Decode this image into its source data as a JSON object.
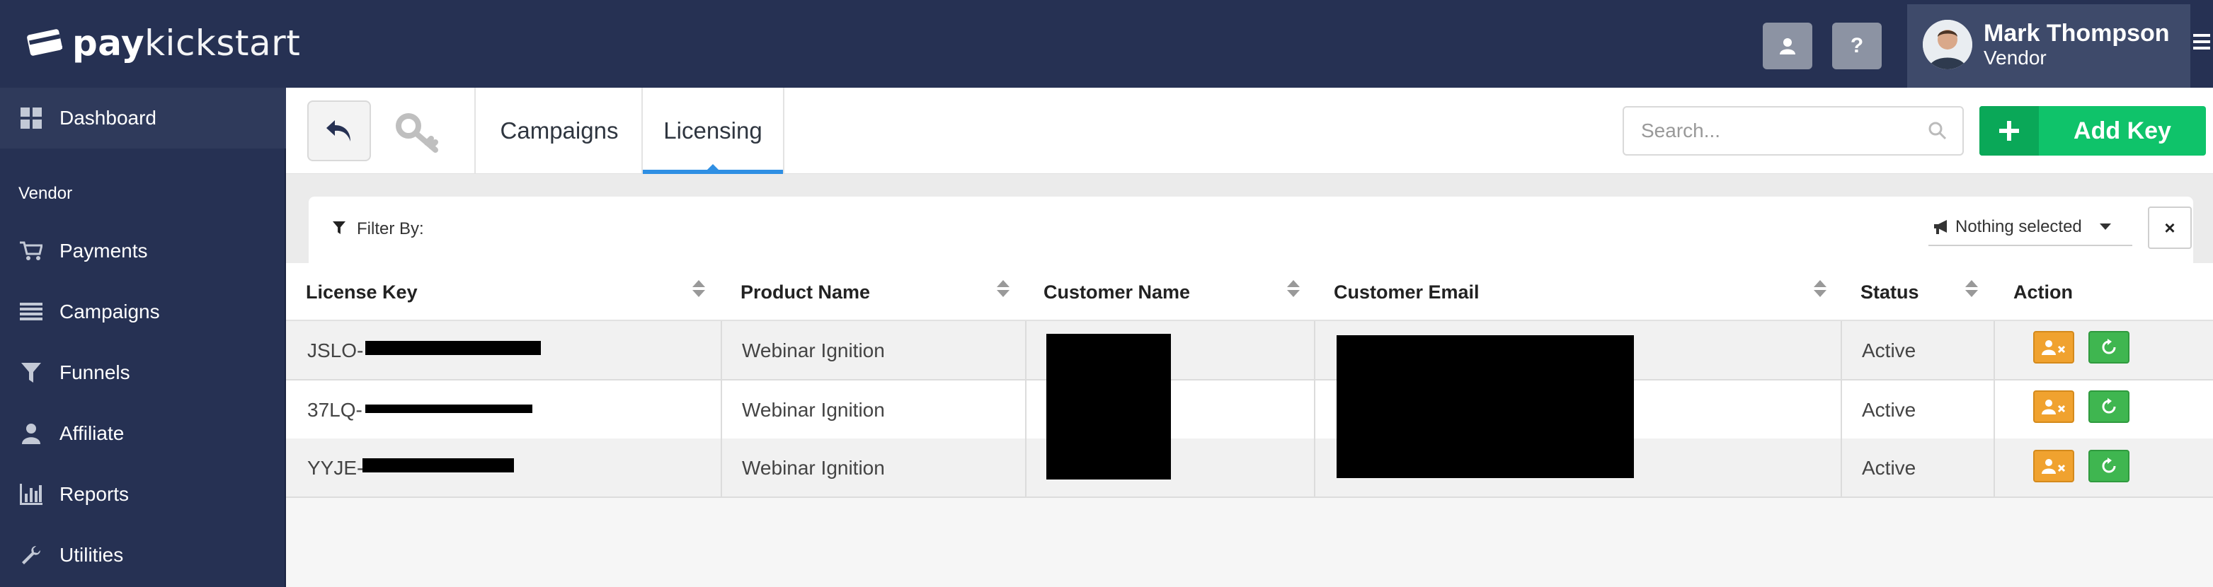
{
  "header": {
    "logo_bold": "pay",
    "logo_light": "kickstart",
    "user_button_icon": "user-icon",
    "help_label": "?",
    "profile": {
      "name": "Mark Thompson",
      "role": "Vendor"
    }
  },
  "sidebar": {
    "section_label": "Vendor",
    "items": [
      {
        "label": "Dashboard",
        "icon": "grid-icon"
      },
      {
        "label": "Payments",
        "icon": "cart-icon"
      },
      {
        "label": "Campaigns",
        "icon": "list-icon"
      },
      {
        "label": "Funnels",
        "icon": "filter-icon"
      },
      {
        "label": "Affiliate",
        "icon": "person-icon"
      },
      {
        "label": "Reports",
        "icon": "bar-chart-icon"
      },
      {
        "label": "Utilities",
        "icon": "wrench-icon"
      }
    ]
  },
  "toolbar": {
    "tabs": [
      {
        "label": "Campaigns",
        "active": false
      },
      {
        "label": "Licensing",
        "active": true
      }
    ],
    "search_placeholder": "Search...",
    "add_key_label": "Add Key",
    "add_key_icon": "plus-icon"
  },
  "filter": {
    "label": "Filter By:",
    "dropdown_value": "Nothing selected",
    "clear_label": "×"
  },
  "table": {
    "columns": [
      "License Key",
      "Product Name",
      "Customer Name",
      "Customer Email",
      "Status",
      "Action"
    ],
    "rows": [
      {
        "license_prefix": "JSLO-",
        "product": "Webinar Ignition",
        "status": "Active"
      },
      {
        "license_prefix": "37LQ-",
        "product": "Webinar Ignition",
        "status": "Active"
      },
      {
        "license_prefix": "YYJE-",
        "product": "Webinar Ignition",
        "status": "Active"
      }
    ]
  },
  "colors": {
    "topbar": "#263153",
    "accent_green": "#0fc36a",
    "tab_underline": "#2f8fe3",
    "action_orange": "#f0a22f",
    "action_green": "#3fb650"
  }
}
